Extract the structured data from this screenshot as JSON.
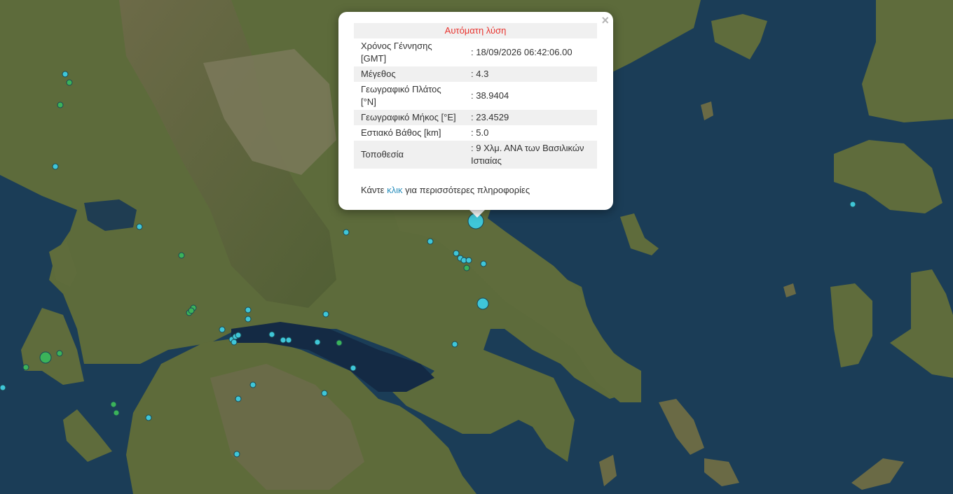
{
  "popup": {
    "status": "Αυτόματη λύση",
    "rows": [
      {
        "label": "Χρόνος Γέννησης [GMT]",
        "value": ": 18/09/2026 06:42:06.00"
      },
      {
        "label": "Μέγεθος",
        "value": ": 4.3"
      },
      {
        "label": "Γεωγραφικό Πλάτος [°N]",
        "value": ": 38.9404"
      },
      {
        "label": "Γεωγραφικό Μήκος [°E]",
        "value": ": 23.4529"
      },
      {
        "label": "Εστιακό Βάθος [km]",
        "value": ": 5.0"
      },
      {
        "label": "Τοποθεσία",
        "value": ": 9 Χλμ. ΑΝΑ των Βασιλικών Ιστιαίας"
      }
    ],
    "more_prefix": "Κάντε",
    "more_link": "κλικ",
    "more_suffix": "για περισσότερες πληροφορίες",
    "close_symbol": "×"
  },
  "colors": {
    "sea": "#1b3d57",
    "land": "#5b6b3a",
    "quake_automatic": "#3fc6d8",
    "quake_manual": "#3bb35a",
    "popup_status": "#e8332e",
    "link": "#2a8fbd"
  }
}
